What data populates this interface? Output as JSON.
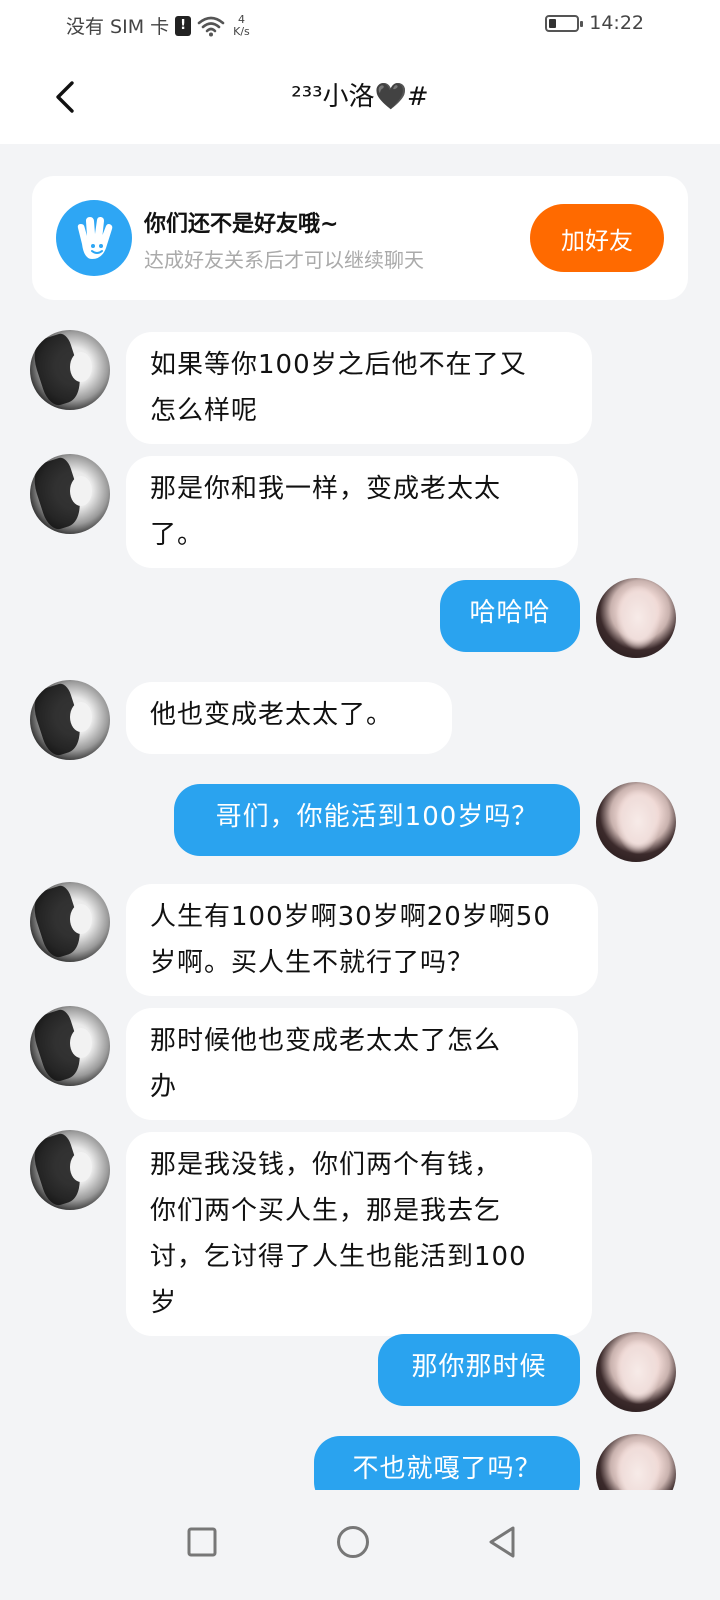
{
  "status_bar": {
    "carrier": "没有 SIM 卡",
    "sim_badge": "!",
    "speed_value": "4",
    "speed_unit": "K/s",
    "time": "14:22",
    "battery_level": 0.25
  },
  "header": {
    "back_icon": "chevron-left-icon",
    "title": "²³³小洛🖤#"
  },
  "friend_card": {
    "icon": "hand-wave-icon",
    "title": "你们还不是好友哦~",
    "subtitle": "达成好友关系后才可以继续聊天",
    "add_button_label": "加好友",
    "accent_color": "#ff6a00"
  },
  "messages": [
    {
      "sender": "other",
      "text": "如果等你100岁之后他不在了又\n怎么样呢"
    },
    {
      "sender": "other",
      "text": "那是你和我一样，变成老太太\n了。"
    },
    {
      "sender": "self",
      "text": "哈哈哈"
    },
    {
      "sender": "other",
      "text": "他也变成老太太了。"
    },
    {
      "sender": "self",
      "text": "哥们，你能活到100岁吗？"
    },
    {
      "sender": "other",
      "text": "人生有100岁啊30岁啊20岁啊50\n岁啊。买人生不就行了吗？"
    },
    {
      "sender": "other",
      "text": "那时候他也变成老太太了怎么\n办"
    },
    {
      "sender": "other",
      "text": "那是我没钱，你们两个有钱，\n你们两个买人生，那是我去乞\n讨，乞讨得了人生也能活到100\n岁"
    },
    {
      "sender": "self",
      "text": "那你那时候"
    },
    {
      "sender": "self",
      "text": "不也就嘎了吗？"
    }
  ],
  "nav_bar": {
    "recent_icon": "square-icon",
    "home_icon": "circle-icon",
    "back_icon": "triangle-back-icon"
  },
  "colors": {
    "self_bubble": "#2aa3ef",
    "background": "#f3f4f6"
  }
}
